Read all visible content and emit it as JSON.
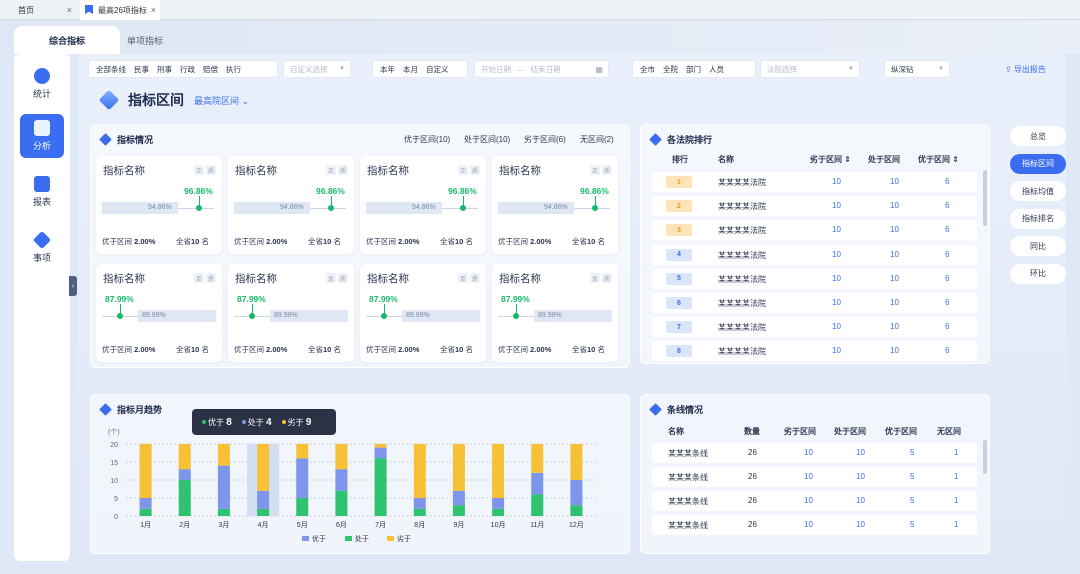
{
  "tabs": [
    {
      "label": "首页"
    },
    {
      "label": "最高26项指标"
    }
  ],
  "subtabs": [
    "综合指标",
    "单项指标"
  ],
  "sidebar": [
    {
      "label": "统计"
    },
    {
      "label": "分析"
    },
    {
      "label": "报表"
    },
    {
      "label": "事项"
    }
  ],
  "filters": {
    "group1": [
      "全部条线",
      "民事",
      "刑事",
      "行政",
      "赔偿",
      "执行"
    ],
    "custom_select": "自定义选择",
    "group2": [
      "本年",
      "本月",
      "自定义"
    ],
    "start_date": "开始日期",
    "dash": "—",
    "end_date": "结束日期",
    "group3": [
      "全市",
      "全院",
      "部门",
      "人员"
    ],
    "court_select": "法院选择",
    "drill": "纵深钻",
    "export": "导出报告"
  },
  "page": {
    "title": "指标区间",
    "court": "最高院区间"
  },
  "indicator": {
    "title": "指标情况",
    "legend": [
      "优于区间(10)",
      "处于区间(10)",
      "劣于区间(6)",
      "无区间(2)"
    ],
    "cards_top": [
      {
        "name": "指标名称",
        "tag1": "正",
        "tag2": "质",
        "value": "96.86%",
        "bar": "94.86%",
        "left_lbl": "优于区间",
        "left_val": "2.00%",
        "right_lbl": "全省",
        "rank": "10",
        "rank_unit": "名"
      },
      {
        "name": "指标名称",
        "tag1": "正",
        "tag2": "质",
        "value": "96.86%",
        "bar": "94.86%",
        "left_lbl": "优于区间",
        "left_val": "2.00%",
        "right_lbl": "全省",
        "rank": "10",
        "rank_unit": "名"
      },
      {
        "name": "指标名称",
        "tag1": "正",
        "tag2": "质",
        "value": "96.86%",
        "bar": "94.86%",
        "left_lbl": "优于区间",
        "left_val": "2.00%",
        "right_lbl": "全省",
        "rank": "10",
        "rank_unit": "名"
      },
      {
        "name": "指标名称",
        "tag1": "正",
        "tag2": "质",
        "value": "96.86%",
        "bar": "94.86%",
        "left_lbl": "优于区间",
        "left_val": "2.00%",
        "right_lbl": "全省",
        "rank": "10",
        "rank_unit": "名"
      }
    ],
    "cards_bottom": [
      {
        "name": "指标名称",
        "tag1": "反",
        "tag2": "质",
        "value": "87.99%",
        "bar": "89.99%",
        "left_lbl": "优于区间",
        "left_val": "2.00%",
        "right_lbl": "全省",
        "rank": "10",
        "rank_unit": "名"
      },
      {
        "name": "指标名称",
        "tag1": "反",
        "tag2": "质",
        "value": "87.99%",
        "bar": "89.99%",
        "left_lbl": "优于区间",
        "left_val": "2.00%",
        "right_lbl": "全省",
        "rank": "10",
        "rank_unit": "名"
      },
      {
        "name": "指标名称",
        "tag1": "反",
        "tag2": "质",
        "value": "87.99%",
        "bar": "89.99%",
        "left_lbl": "优于区间",
        "left_val": "2.00%",
        "right_lbl": "全省",
        "rank": "10",
        "rank_unit": "名"
      },
      {
        "name": "指标名称",
        "tag1": "反",
        "tag2": "质",
        "value": "87.99%",
        "bar": "89.99%",
        "left_lbl": "优于区间",
        "left_val": "2.00%",
        "right_lbl": "全省",
        "rank": "10",
        "rank_unit": "名"
      }
    ]
  },
  "ranking": {
    "title": "各法院排行",
    "headers": [
      "排行",
      "名称",
      "劣于区间 ⇕",
      "处于区间",
      "优于区间 ⇕"
    ],
    "rows": [
      {
        "rank": "1",
        "name": "某某某某法院",
        "a": "10",
        "b": "10",
        "c": "6"
      },
      {
        "rank": "2",
        "name": "某某某某法院",
        "a": "10",
        "b": "10",
        "c": "6"
      },
      {
        "rank": "3",
        "name": "某某某某法院",
        "a": "10",
        "b": "10",
        "c": "6"
      },
      {
        "rank": "4",
        "name": "某某某某法院",
        "a": "10",
        "b": "10",
        "c": "6"
      },
      {
        "rank": "5",
        "name": "某某某某法院",
        "a": "10",
        "b": "10",
        "c": "6"
      },
      {
        "rank": "6",
        "name": "某某某某法院",
        "a": "10",
        "b": "10",
        "c": "6"
      },
      {
        "rank": "7",
        "name": "某某某某法院",
        "a": "10",
        "b": "10",
        "c": "6"
      },
      {
        "rank": "8",
        "name": "某某某某法院",
        "a": "10",
        "b": "10",
        "c": "6"
      }
    ]
  },
  "right_nav": [
    "总览",
    "指标区间",
    "指标均值",
    "指标排名",
    "同比",
    "环比"
  ],
  "trend": {
    "title": "指标月趋势",
    "tooltip": [
      {
        "label": "优于",
        "value": "8"
      },
      {
        "label": "处于",
        "value": "4"
      },
      {
        "label": "劣于",
        "value": "9"
      }
    ]
  },
  "lines": {
    "title": "条线情况",
    "headers": [
      "名称",
      "数量",
      "劣于区间",
      "处于区间",
      "优于区间",
      "无区间"
    ],
    "rows": [
      {
        "name": "某某某条线",
        "n": "26",
        "a": "10",
        "b": "10",
        "c": "5",
        "d": "1"
      },
      {
        "name": "某某某条线",
        "n": "26",
        "a": "10",
        "b": "10",
        "c": "5",
        "d": "1"
      },
      {
        "name": "某某某条线",
        "n": "26",
        "a": "10",
        "b": "10",
        "c": "5",
        "d": "1"
      },
      {
        "name": "某某某条线",
        "n": "26",
        "a": "10",
        "b": "10",
        "c": "5",
        "d": "1"
      }
    ]
  },
  "chart_data": {
    "type": "bar",
    "stacked": true,
    "categories": [
      "1月",
      "2月",
      "3月",
      "4月",
      "5月",
      "6月",
      "7月",
      "8月",
      "9月",
      "10月",
      "11月",
      "12月"
    ],
    "ylabel": "(个)",
    "ylim": [
      0,
      20
    ],
    "yticks": [
      0,
      5,
      10,
      15,
      20
    ],
    "series": [
      {
        "name": "处于",
        "color": "#2fc26f",
        "values": [
          2,
          10,
          2,
          2,
          5,
          7,
          16,
          2,
          3,
          2,
          6,
          3
        ]
      },
      {
        "name": "优于",
        "color": "#7e95ec",
        "values": [
          3,
          3,
          12,
          5,
          11,
          6,
          3,
          3,
          4,
          3,
          6,
          7
        ]
      },
      {
        "name": "劣于",
        "color": "#f7c136",
        "values": [
          15,
          7,
          6,
          13,
          4,
          7,
          1,
          15,
          13,
          15,
          8,
          10
        ]
      }
    ],
    "legend": [
      "优于",
      "处于",
      "劣于"
    ],
    "highlight": "4月"
  },
  "colors": {
    "accent": "#3a6df0",
    "good": "#17b96a"
  }
}
